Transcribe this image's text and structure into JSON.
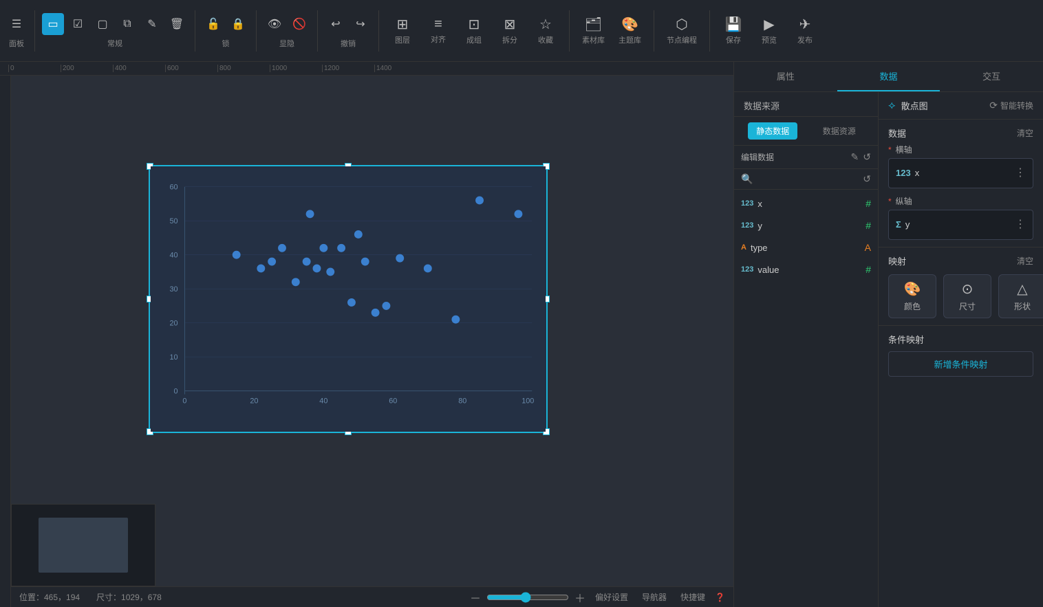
{
  "toolbar": {
    "groups": [
      {
        "label": "面板",
        "items": []
      },
      {
        "label": "常规",
        "items": []
      },
      {
        "label": "锁",
        "items": []
      },
      {
        "label": "显隐",
        "items": []
      },
      {
        "label": "撤销",
        "items": []
      },
      {
        "label": "图层",
        "items": []
      },
      {
        "label": "对齐",
        "items": []
      },
      {
        "label": "成组",
        "items": []
      },
      {
        "label": "拆分",
        "items": []
      },
      {
        "label": "收藏",
        "items": []
      },
      {
        "label": "素材库",
        "items": []
      },
      {
        "label": "主题库",
        "items": []
      },
      {
        "label": "节点编程",
        "items": []
      },
      {
        "label": "保存",
        "items": []
      },
      {
        "label": "预览",
        "items": []
      },
      {
        "label": "发布",
        "items": []
      }
    ]
  },
  "right_tabs": [
    "属性",
    "数据",
    "交互"
  ],
  "active_right_tab": "数据",
  "data_source": {
    "title": "数据来源",
    "tabs": [
      "静态数据",
      "数据资源"
    ],
    "active_tab": "静态数据",
    "edit_label": "编辑数据",
    "fields": [
      {
        "type": "123",
        "name": "x",
        "icon": "hash"
      },
      {
        "type": "123",
        "name": "y",
        "icon": "hash"
      },
      {
        "type": "A",
        "name": "type",
        "icon": "text"
      },
      {
        "type": "123",
        "name": "value",
        "icon": "hash"
      }
    ]
  },
  "data_config": {
    "chart_type": "散点图",
    "smart_convert": "智能转换",
    "data_label": "数据",
    "clear_label": "清空",
    "x_axis_label": "横轴",
    "y_axis_label": "纵轴",
    "x_field": {
      "prefix": "123",
      "name": "x"
    },
    "y_field": {
      "prefix": "Σ",
      "name": "y"
    },
    "mapping_label": "映射",
    "mapping_clear": "清空",
    "mapping_items": [
      "颜色",
      "尺寸",
      "形状"
    ],
    "condition_label": "条件映射",
    "add_condition": "新增条件映射"
  },
  "status": {
    "position": "位置：465，194",
    "size": "尺寸：1029，678",
    "preference": "偏好设置",
    "guide": "导航器",
    "shortcut": "快捷键",
    "zoom_percent": "100%"
  },
  "ruler_ticks": [
    "0",
    "200",
    "400",
    "600",
    "800",
    "1000",
    "1200",
    "1400"
  ],
  "scatter_data": [
    {
      "x": 15,
      "y": 40
    },
    {
      "x": 22,
      "y": 36
    },
    {
      "x": 25,
      "y": 38
    },
    {
      "x": 28,
      "y": 42
    },
    {
      "x": 32,
      "y": 32
    },
    {
      "x": 35,
      "y": 38
    },
    {
      "x": 38,
      "y": 36
    },
    {
      "x": 40,
      "y": 42
    },
    {
      "x": 42,
      "y": 35
    },
    {
      "x": 45,
      "y": 42
    },
    {
      "x": 48,
      "y": 26
    },
    {
      "x": 50,
      "y": 46
    },
    {
      "x": 52,
      "y": 38
    },
    {
      "x": 55,
      "y": 23
    },
    {
      "x": 58,
      "y": 25
    },
    {
      "x": 62,
      "y": 39
    },
    {
      "x": 70,
      "y": 36
    },
    {
      "x": 36,
      "y": 52
    },
    {
      "x": 78,
      "y": 21
    },
    {
      "x": 85,
      "y": 56
    },
    {
      "x": 96,
      "y": 52
    }
  ]
}
